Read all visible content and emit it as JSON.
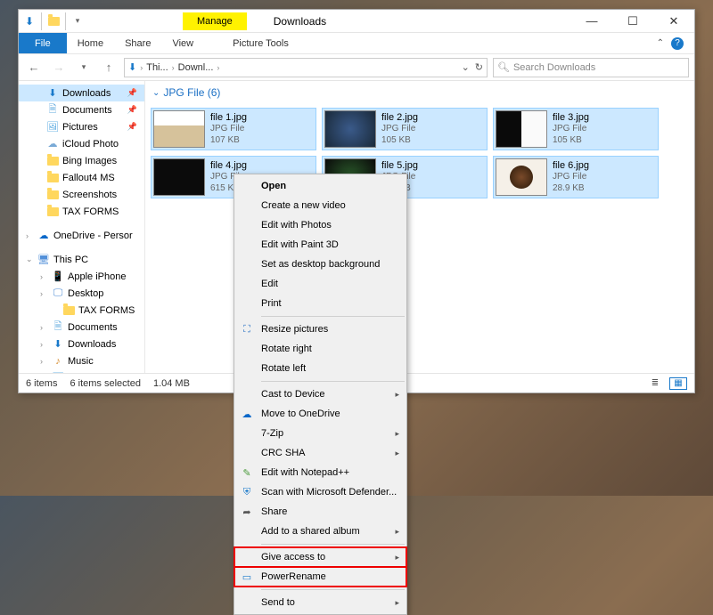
{
  "window": {
    "title": "Downloads",
    "ribbon_highlight": "Manage",
    "ribbon_sub": "Picture Tools",
    "tabs": {
      "file": "File",
      "home": "Home",
      "share": "Share",
      "view": "View"
    }
  },
  "addr": {
    "root": "Thi...",
    "folder": "Downl...",
    "search_placeholder": "Search Downloads"
  },
  "sidebar": {
    "quick": [
      {
        "label": "Downloads",
        "icon": "download",
        "pin": true,
        "active": true
      },
      {
        "label": "Documents",
        "icon": "doc",
        "pin": true
      },
      {
        "label": "Pictures",
        "icon": "pic",
        "pin": true
      },
      {
        "label": "iCloud Photo",
        "icon": "cloud"
      },
      {
        "label": "Bing Images",
        "icon": "folder"
      },
      {
        "label": "Fallout4 MS",
        "icon": "folder"
      },
      {
        "label": "Screenshots",
        "icon": "folder"
      },
      {
        "label": "TAX FORMS",
        "icon": "folder"
      }
    ],
    "onedrive": "OneDrive - Persor",
    "thispc": {
      "label": "This PC",
      "children": [
        {
          "label": "Apple iPhone",
          "icon": "phone"
        },
        {
          "label": "Desktop",
          "icon": "desktop"
        },
        {
          "label": "TAX FORMS",
          "icon": "folder",
          "indent": true
        },
        {
          "label": "Documents",
          "icon": "doc"
        },
        {
          "label": "Downloads",
          "icon": "download"
        },
        {
          "label": "Music",
          "icon": "music"
        },
        {
          "label": "Pictures",
          "icon": "pic"
        }
      ]
    }
  },
  "group_header": "JPG File (6)",
  "files": [
    {
      "name": "file 1.jpg",
      "type": "JPG File",
      "size": "107 KB",
      "thumb": "t1"
    },
    {
      "name": "file 2.jpg",
      "type": "JPG File",
      "size": "105 KB",
      "thumb": "t2"
    },
    {
      "name": "file 3.jpg",
      "type": "JPG File",
      "size": "105 KB",
      "thumb": "t3"
    },
    {
      "name": "file 4.jpg",
      "type": "JPG File",
      "size": "615 KB",
      "thumb": "t4"
    },
    {
      "name": "file 5.jpg",
      "type": "JPG File",
      "size": "105 KB",
      "thumb": "t5"
    },
    {
      "name": "file 6.jpg",
      "type": "JPG File",
      "size": "28.9 KB",
      "thumb": "t6"
    }
  ],
  "status": {
    "items": "6 items",
    "selected": "6 items selected",
    "size": "1.04 MB"
  },
  "ctx": {
    "open": "Open",
    "video": "Create a new video",
    "photos": "Edit with Photos",
    "paint3d": "Edit with Paint 3D",
    "wallpaper": "Set as desktop background",
    "edit": "Edit",
    "print": "Print",
    "resize": "Resize pictures",
    "rot_r": "Rotate right",
    "rot_l": "Rotate left",
    "cast": "Cast to Device",
    "onedrive": "Move to OneDrive",
    "zip": "7-Zip",
    "crc": "CRC SHA",
    "npp": "Edit with Notepad++",
    "defender": "Scan with Microsoft Defender...",
    "share": "Share",
    "album": "Add to a shared album",
    "access": "Give access to",
    "powerrename": "PowerRename",
    "sendto": "Send to"
  }
}
